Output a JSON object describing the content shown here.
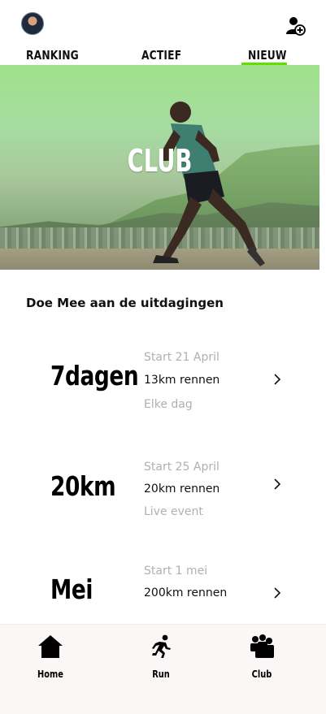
{
  "header": {
    "avatar_icon": "avatar",
    "add_user_icon": "add-user-icon"
  },
  "tabs": [
    {
      "label": "RANKING",
      "active": false
    },
    {
      "label": "ACTIEF",
      "active": false
    },
    {
      "label": "NIEUW",
      "active": true
    }
  ],
  "colors": {
    "accent": "#5fe000",
    "muted_text": "#b0b0b0",
    "bottom_nav_bg": "#fbf7f7"
  },
  "hero": {
    "title": "CLUB"
  },
  "section": {
    "heading": "Doe Mee aan de uitdagingen"
  },
  "challenges": [
    {
      "title": "7dagen",
      "start": "Start 21 April",
      "distance": "13km rennen",
      "note": "Elke dag"
    },
    {
      "title": "20km",
      "start": "Start 25 April",
      "distance": "20km rennen",
      "note": "Live event"
    },
    {
      "title": "Mei",
      "start": "Start 1 mei",
      "distance": "200km rennen",
      "note": ""
    }
  ],
  "bottom_nav": [
    {
      "label": "Home",
      "icon": "home-icon"
    },
    {
      "label": "Run",
      "icon": "run-icon"
    },
    {
      "label": "Club",
      "icon": "club-icon"
    }
  ]
}
